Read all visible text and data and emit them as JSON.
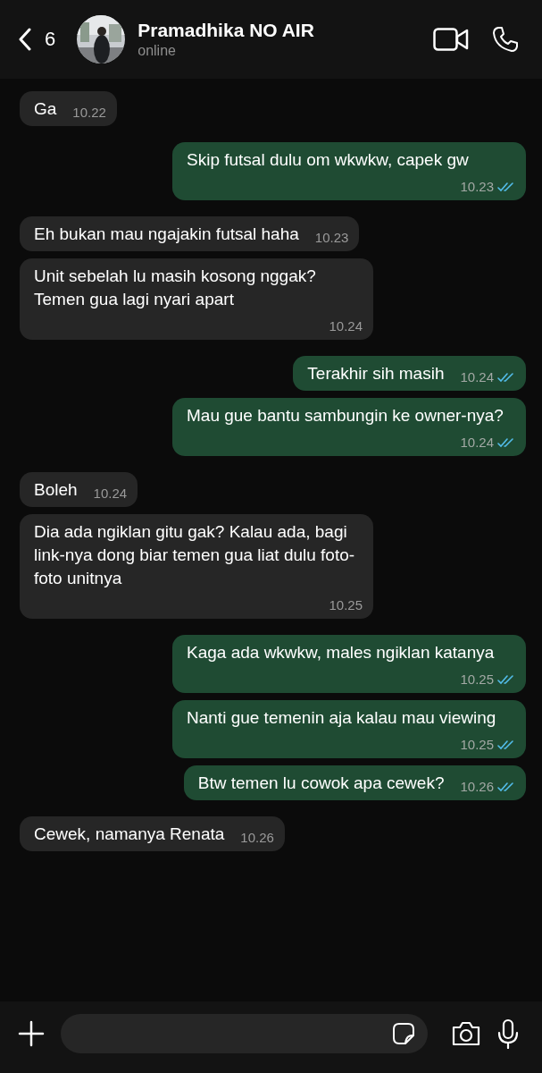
{
  "header": {
    "back_count": "6",
    "contact_name": "Pramadhika NO AIR",
    "status": "online"
  },
  "messages": [
    {
      "kind": "incoming",
      "text": "Ga",
      "time": "10.22"
    },
    {
      "kind": "outgoing",
      "text": "Skip futsal dulu om wkwkw, capek gw",
      "time": "10.23",
      "read": true
    },
    {
      "kind": "incoming",
      "text": "Eh bukan mau ngajakin futsal haha",
      "time": "10.23"
    },
    {
      "kind": "incoming",
      "text": "Unit sebelah lu masih kosong nggak? Temen gua lagi nyari apart",
      "time": "10.24"
    },
    {
      "kind": "outgoing",
      "text": "Terakhir sih masih",
      "time": "10.24",
      "read": true
    },
    {
      "kind": "outgoing",
      "text": "Mau gue bantu sambungin ke owner-nya?",
      "time": "10.24",
      "read": true
    },
    {
      "kind": "incoming",
      "text": "Boleh",
      "time": "10.24"
    },
    {
      "kind": "incoming",
      "text": "Dia ada ngiklan gitu gak? Kalau ada, bagi link-nya dong biar temen gua liat dulu foto-foto unitnya",
      "time": "10.25"
    },
    {
      "kind": "outgoing",
      "text": "Kaga ada wkwkw, males ngiklan katanya",
      "time": "10.25",
      "read": true
    },
    {
      "kind": "outgoing",
      "text": "Nanti gue temenin aja kalau mau viewing",
      "time": "10.25",
      "read": true
    },
    {
      "kind": "outgoing",
      "text": "Btw temen lu cowok apa cewek?",
      "time": "10.26",
      "read": true
    },
    {
      "kind": "incoming",
      "text": "Cewek, namanya Renata",
      "time": "10.26"
    }
  ]
}
